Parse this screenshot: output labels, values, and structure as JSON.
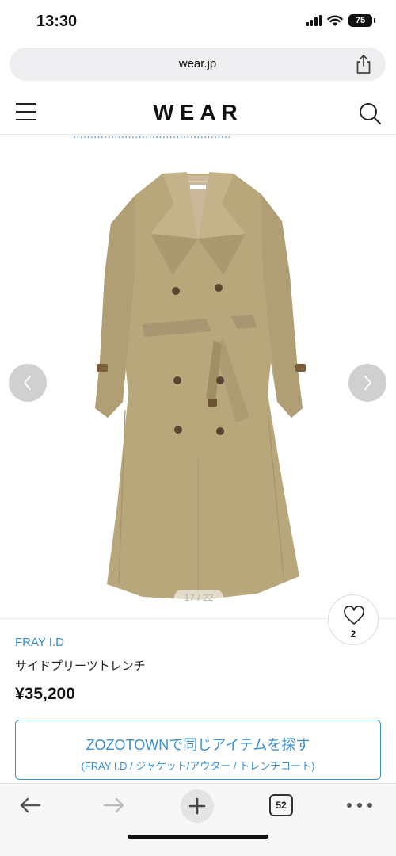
{
  "status": {
    "time": "13:30",
    "battery": "75"
  },
  "browser": {
    "url": "wear.jp",
    "tab_count": "52"
  },
  "header": {
    "logo": "WEAR"
  },
  "gallery": {
    "counter": "17 / 22"
  },
  "product": {
    "brand": "FRAY I.D",
    "name": "サイドプリーツトレンチ",
    "price": "¥35,200",
    "like_count": "2",
    "image_label": "FRAY I.D"
  },
  "zozo_button": {
    "title": "ZOZOTOWNで同じアイテムを探す",
    "subtitle": "(FRAY I.D / ジャケット/アウター / トレンチコート)"
  },
  "colors": {
    "accent": "#3a8fd0",
    "coat": "#b9a77c"
  },
  "icons": [
    "signal-icon",
    "wifi-icon",
    "battery-icon",
    "share-icon",
    "menu-icon",
    "search-icon",
    "chevron-left-icon",
    "chevron-right-icon",
    "heart-icon",
    "back-icon",
    "forward-icon",
    "plus-icon",
    "tabs-icon",
    "more-icon"
  ]
}
